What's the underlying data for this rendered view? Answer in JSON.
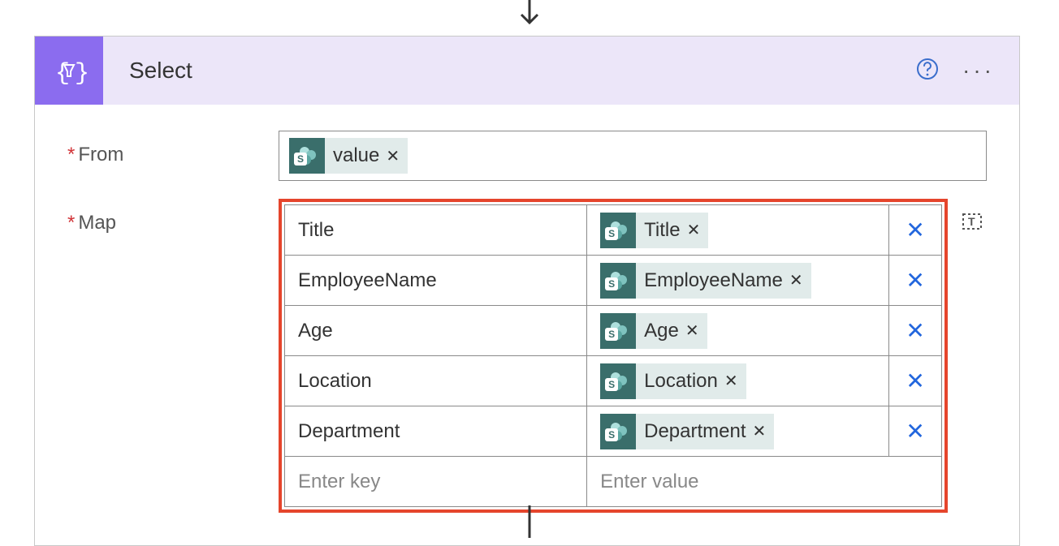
{
  "action": {
    "title": "Select"
  },
  "fields": {
    "from_label": "From",
    "map_label": "Map",
    "from_token": "value",
    "key_placeholder": "Enter key",
    "value_placeholder": "Enter value"
  },
  "map_rows": [
    {
      "key": "Title",
      "value_token": "Title"
    },
    {
      "key": "EmployeeName",
      "value_token": "EmployeeName"
    },
    {
      "key": "Age",
      "value_token": "Age"
    },
    {
      "key": "Location",
      "value_token": "Location"
    },
    {
      "key": "Department",
      "value_token": "Department"
    }
  ],
  "token_icon_letter": "S"
}
